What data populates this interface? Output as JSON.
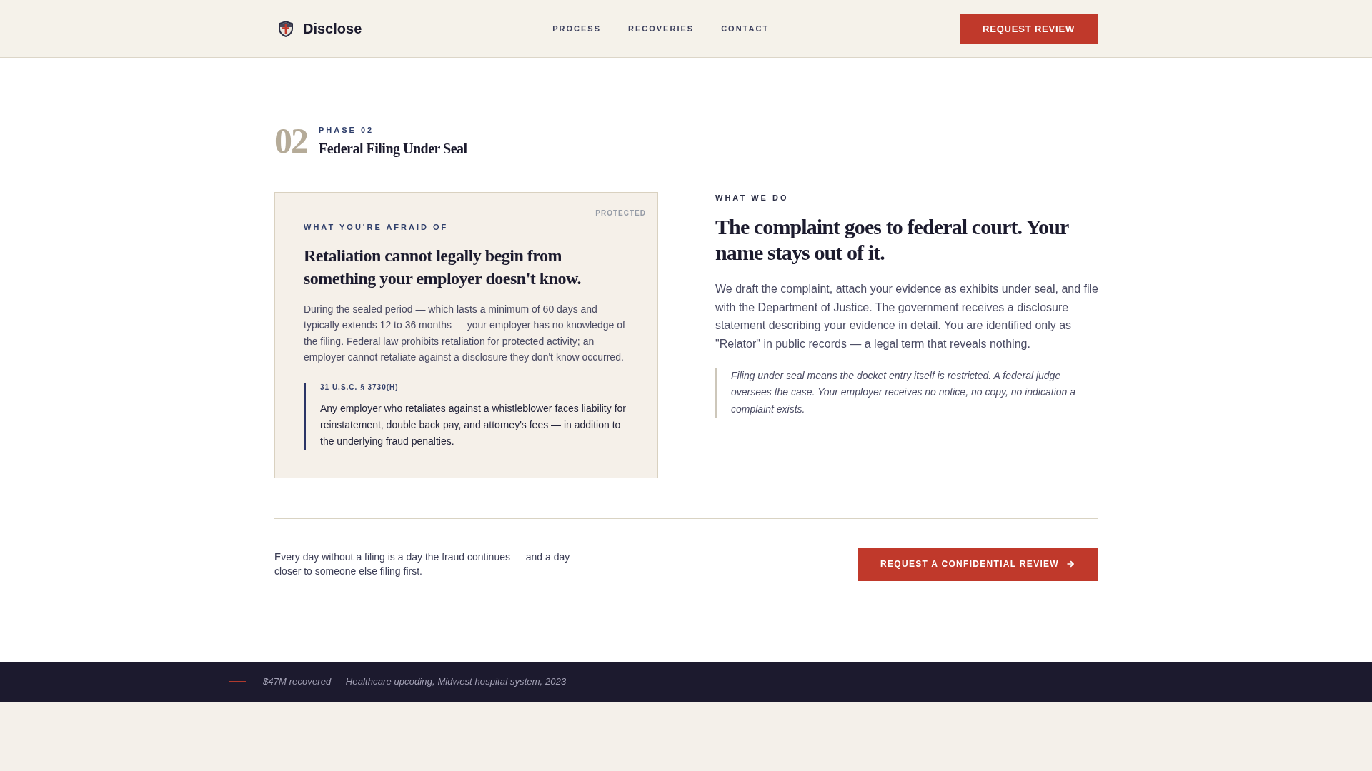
{
  "header": {
    "logo": "Disclose",
    "nav": [
      "PROCESS",
      "RECOVERIES",
      "CONTACT"
    ],
    "button": "REQUEST REVIEW"
  },
  "phase": {
    "number": "02",
    "label": "PHASE 02",
    "title": "Federal Filing Under Seal"
  },
  "fear_card": {
    "tag": "PROTECTED",
    "label": "WHAT YOU'RE AFRAID OF",
    "heading": "Retaliation cannot legally begin from something your employer doesn't know.",
    "body": "During the sealed period — which lasts a minimum of 60 days and typically extends 12 to 36 months — your employer has no knowledge of the filing. Federal law prohibits retaliation for protected activity; an employer cannot retaliate against a disclosure they don't know occurred.",
    "statute": {
      "citation": "31 U.S.C. § 3730(H)",
      "text": "Any employer who retaliates against a whistleblower faces liability for reinstatement, double back pay, and attorney's fees — in addition to the underlying fraud penalties."
    }
  },
  "what_we_do": {
    "label": "WHAT WE DO",
    "heading": "The complaint goes to federal court. Your name stays out of it.",
    "body": "We draft the complaint, attach your evidence as exhibits under seal, and file with the Department of Justice. The government receives a disclosure statement describing your evidence in detail. You are identified only as \"Relator\" in public records — a legal term that reveals nothing.",
    "note": "Filing under seal means the docket entry itself is restricted. A federal judge oversees the case. Your employer receives no notice, no copy, no indication a complaint exists."
  },
  "cta": {
    "text": "Every day without a filing is a day the fraud continues — and a day closer to someone else filing first.",
    "button": "REQUEST A CONFIDENTIAL REVIEW"
  },
  "footer": {
    "text": "$47M recovered — Healthcare upcoding, Midwest hospital system, 2023"
  }
}
